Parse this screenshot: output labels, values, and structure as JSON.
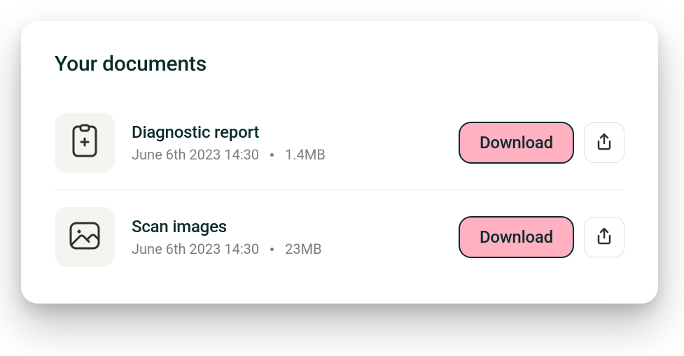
{
  "card": {
    "title": "Your documents",
    "documents": [
      {
        "icon": "clipboard",
        "name": "Diagnostic report",
        "date": "June 6th 2023 14:30",
        "size": "1.4MB",
        "download_label": "Download"
      },
      {
        "icon": "image",
        "name": "Scan images",
        "date": "June 6th 2023 14:30",
        "size": "23MB",
        "download_label": "Download"
      }
    ]
  },
  "colors": {
    "accent": "#ffb0c1",
    "text_dark": "#0b2c2c",
    "text_muted": "#7d7d78",
    "icon_bg": "#f4f4f1"
  }
}
